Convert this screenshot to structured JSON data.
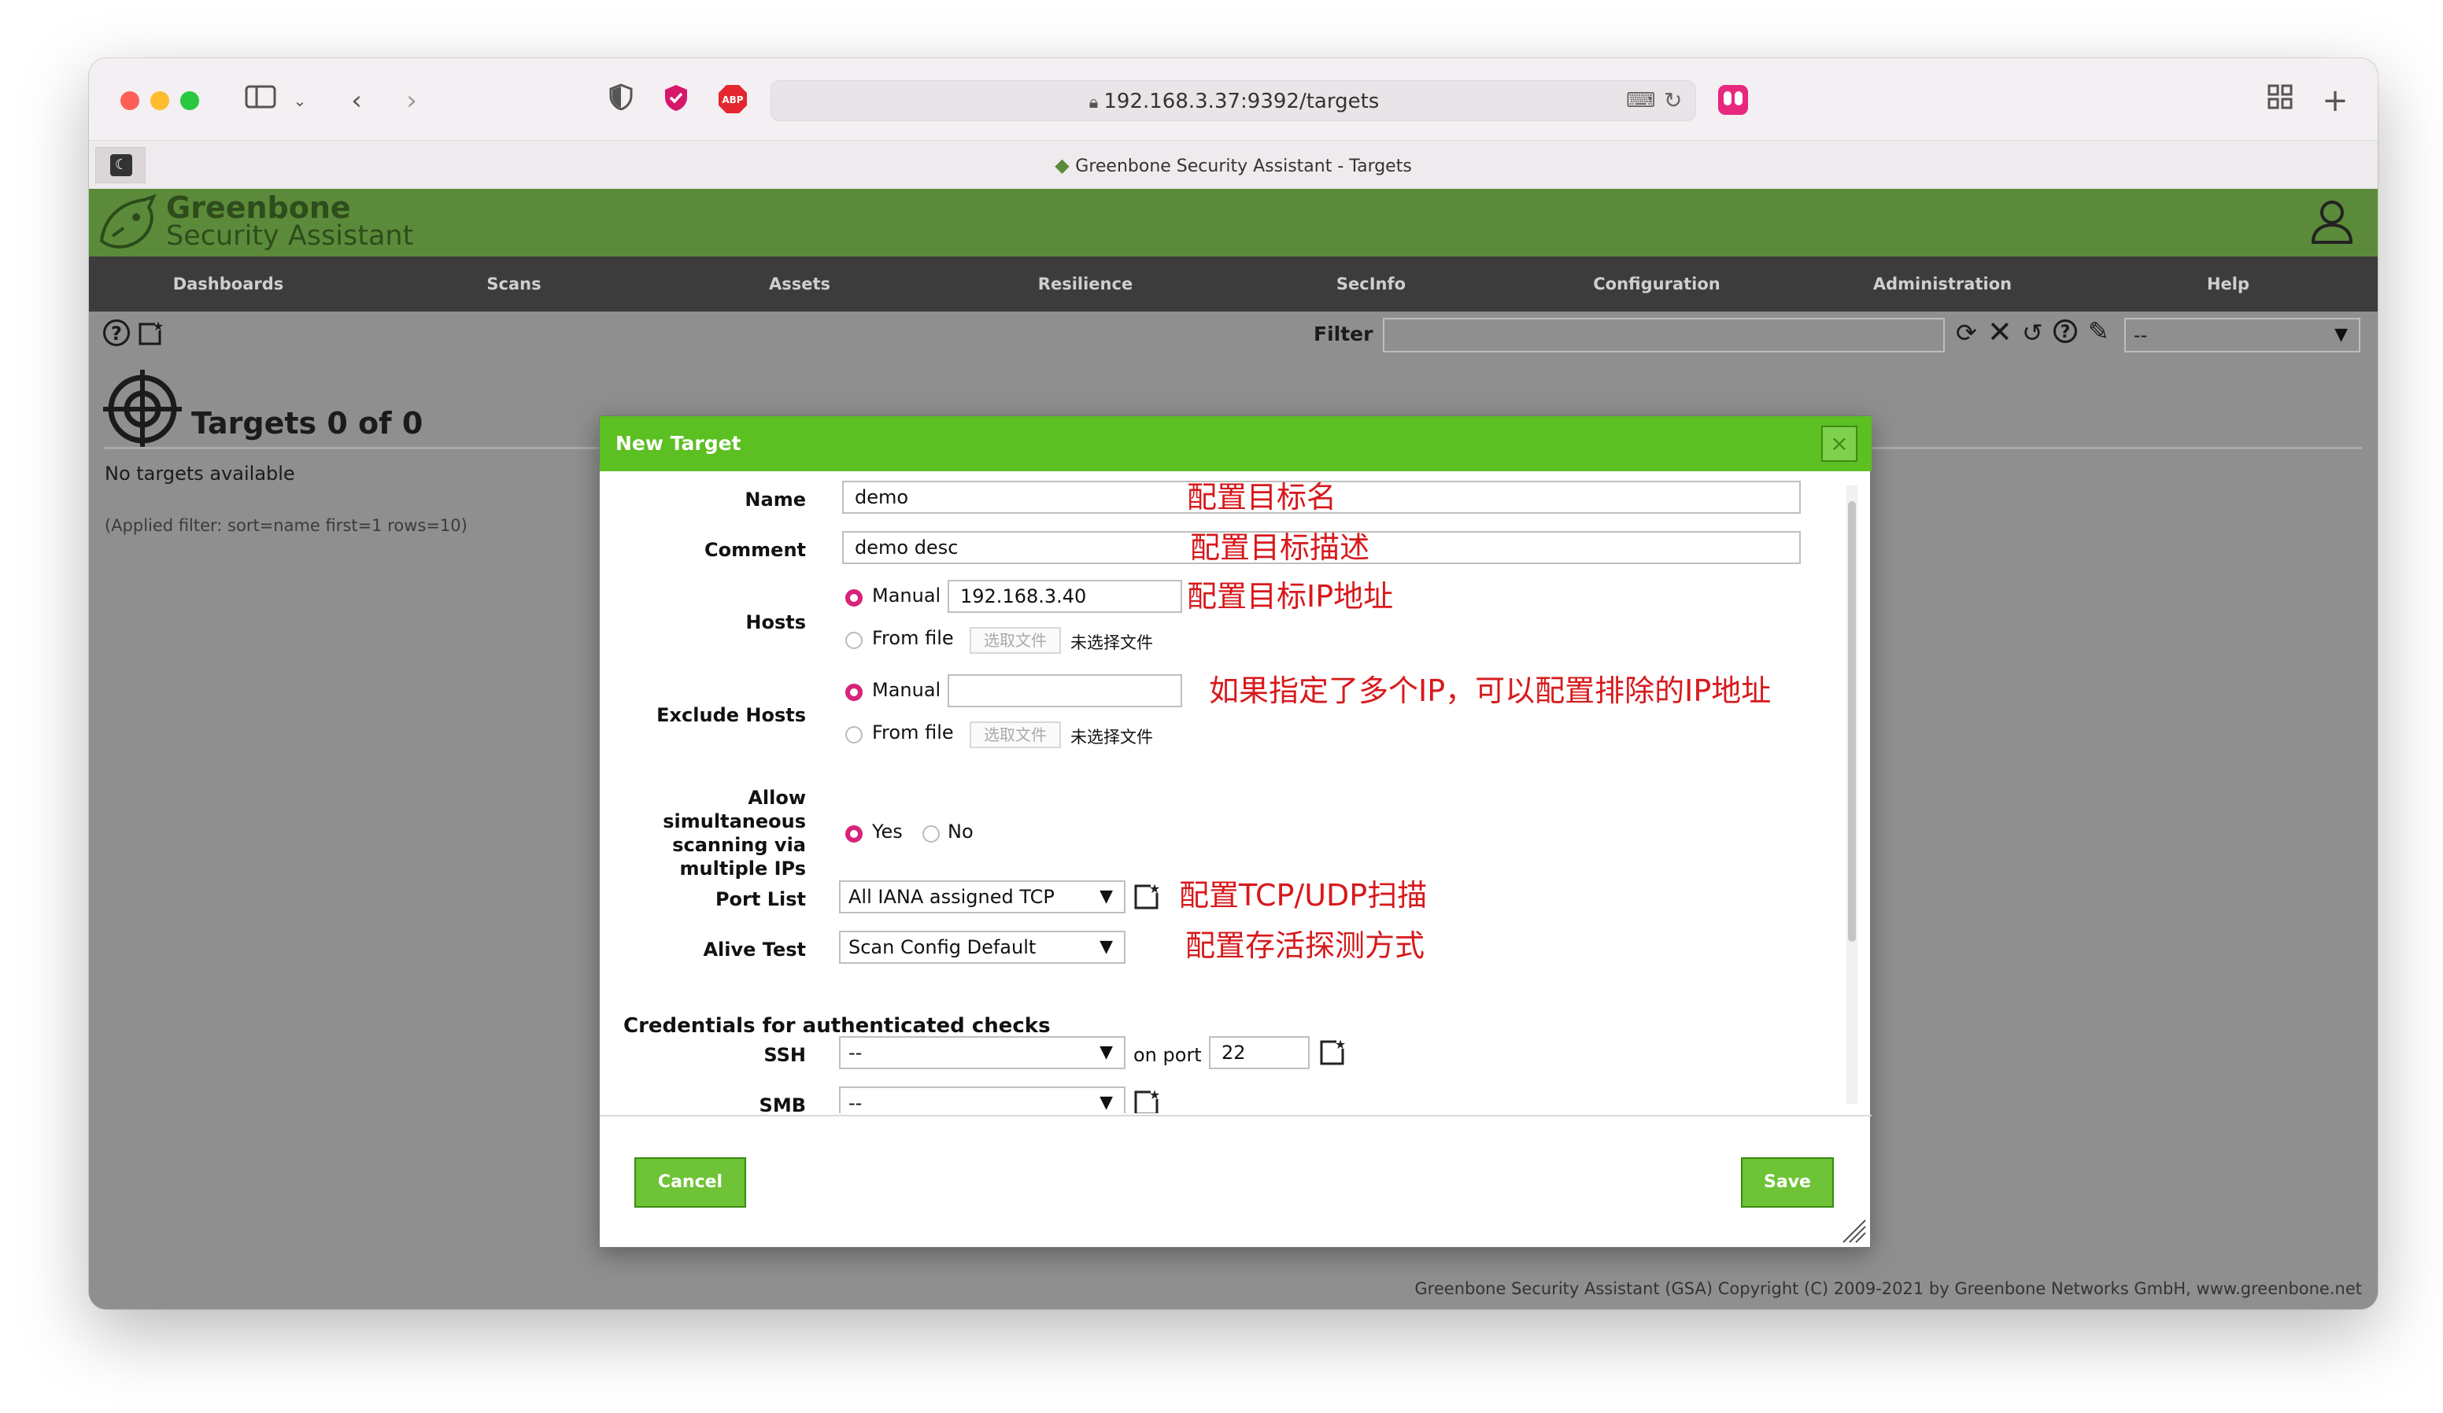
{
  "browser": {
    "url": "192.168.3.37:9392/targets",
    "tab_title": "Greenbone Security Assistant - Targets"
  },
  "app": {
    "logo_line1": "Greenbone",
    "logo_line2": "Security Assistant",
    "menu": [
      "Dashboards",
      "Scans",
      "Assets",
      "Resilience",
      "SecInfo",
      "Configuration",
      "Administration",
      "Help"
    ],
    "filter_label": "Filter",
    "filter_value": "",
    "filter_select": "--",
    "page_title": "Targets 0 of 0",
    "empty_text": "No targets available",
    "applied_filter": "(Applied filter: sort=name first=1 rows=10)",
    "footer": "Greenbone Security Assistant (GSA) Copyright (C) 2009-2021 by Greenbone Networks GmbH, www.greenbone.net"
  },
  "dialog": {
    "title": "New Target",
    "close": "×",
    "name_label": "Name",
    "name_value": "demo",
    "comment_label": "Comment",
    "comment_value": "demo desc",
    "hosts_label": "Hosts",
    "manual_label": "Manual",
    "hosts_value": "192.168.3.40",
    "from_file_label": "From file",
    "choose_file": "选取文件",
    "no_file": "未选择文件",
    "exclude_label": "Exclude Hosts",
    "exclude_value": "",
    "allow_label": [
      "Allow",
      "simultaneous",
      "scanning via",
      "multiple IPs"
    ],
    "yes": "Yes",
    "no": "No",
    "port_list_label": "Port List",
    "port_list_value": "All IANA assigned TCP",
    "alive_label": "Alive Test",
    "alive_value": "Scan Config Default",
    "cred_header": "Credentials for authenticated checks",
    "ssh_label": "SSH",
    "ssh_value": "--",
    "on_port": "on port",
    "port_value": "22",
    "smb_label": "SMB",
    "smb_value": "--",
    "cancel": "Cancel",
    "save": "Save"
  },
  "annotations": {
    "name": "配置目标名",
    "comment": "配置目标描述",
    "hosts": "配置目标IP地址",
    "exclude": "如果指定了多个IP，可以配置排除的IP地址",
    "port": "配置TCP/UDP扫描",
    "alive": "配置存活探测方式"
  },
  "colors": {
    "header_green": "#5b8b3a",
    "dialog_green": "#5cbf22",
    "annotation_red": "#d7191c",
    "radio_magenta": "#d8237a"
  }
}
